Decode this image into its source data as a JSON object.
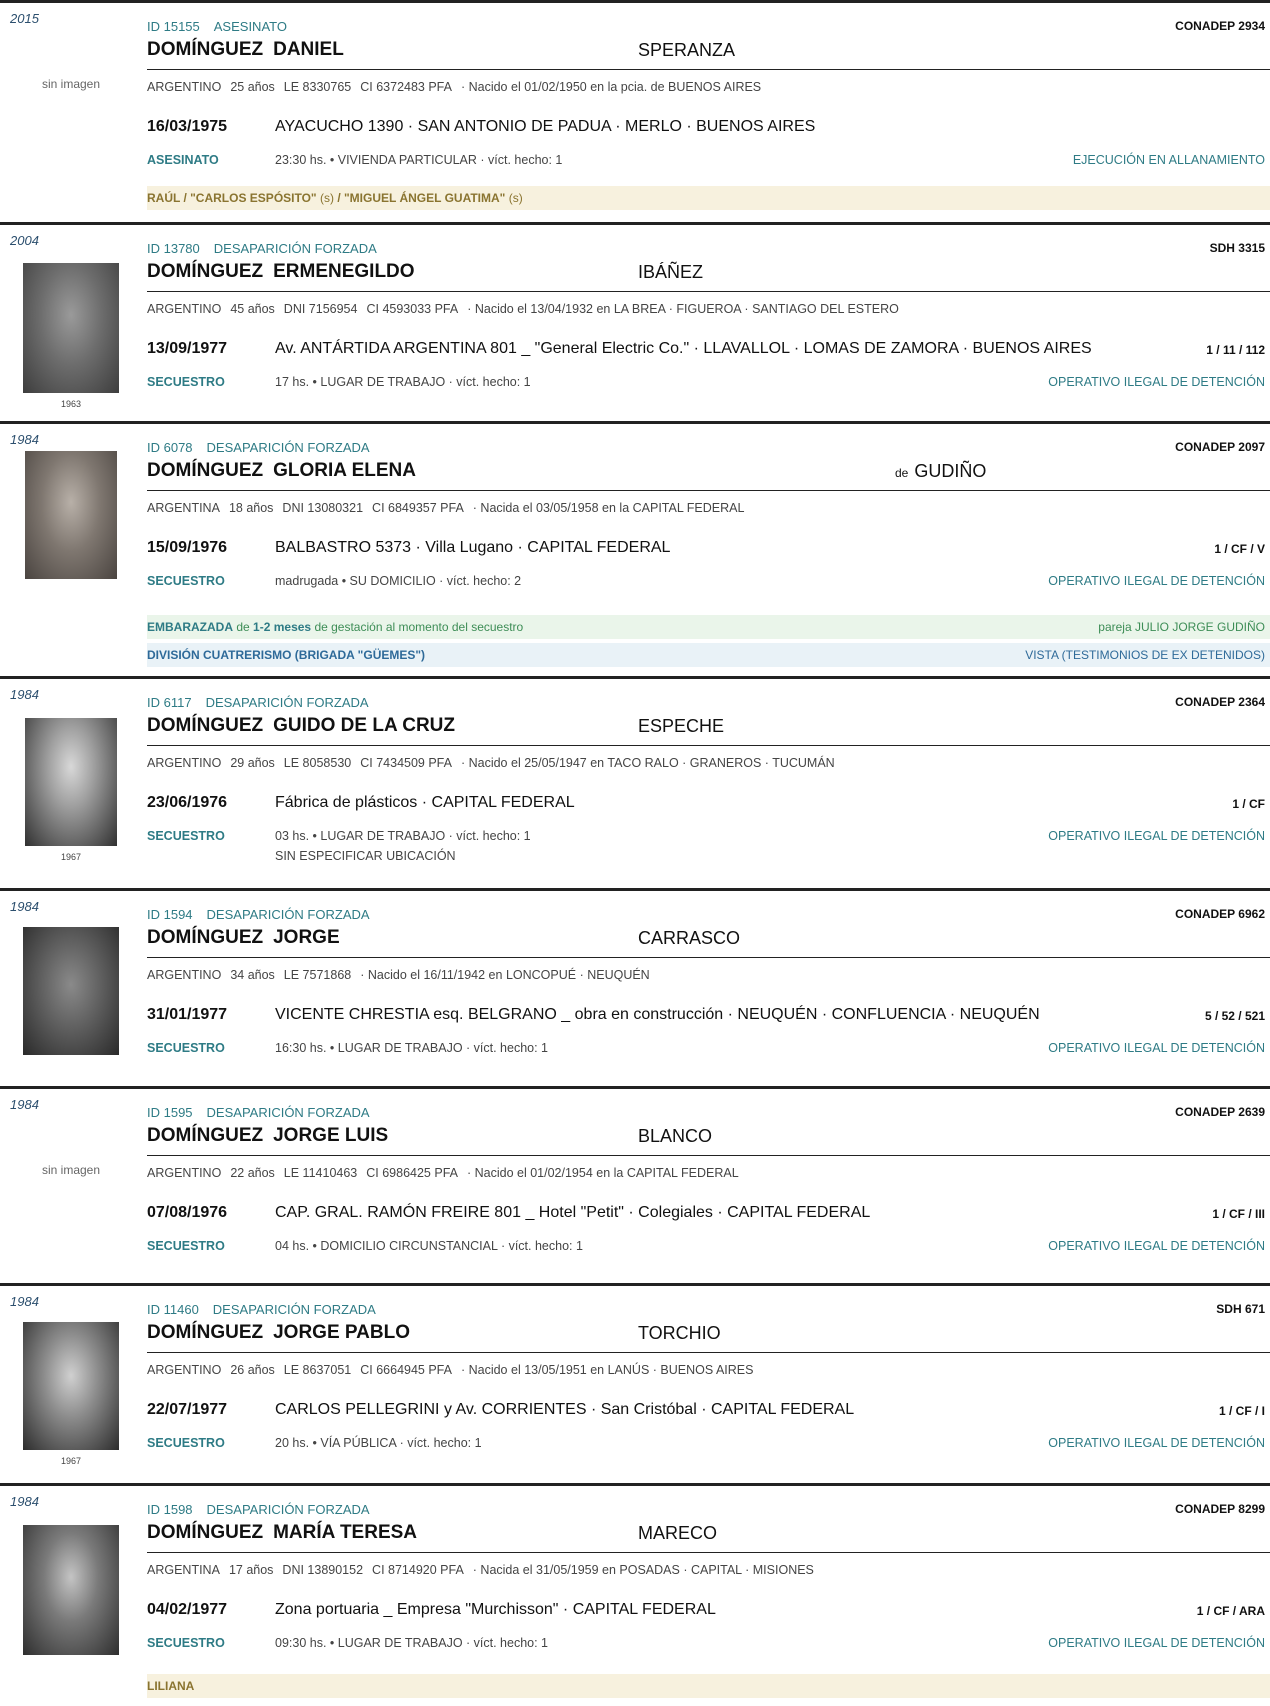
{
  "records": [
    {
      "year": "2015",
      "no_image": "sin imagen",
      "id": "ID 15155",
      "category": "ASESINATO",
      "source": "CONADEP  2934",
      "surname": "DOMÍNGUEZ",
      "firstname": "DANIEL",
      "maternal": "SPERANZA",
      "nationality": "ARGENTINO",
      "age": "25 años",
      "doc1": "LE 8330765",
      "doc2": "CI 6372483 PFA",
      "birth": "·  Nacido el 01/02/1950 en la pcia. de BUENOS AIRES",
      "event_date": "16/03/1975",
      "event_place": "AYACUCHO 1390   ·   SAN ANTONIO DE PADUA · MERLO · BUENOS AIRES",
      "type": "ASESINATO",
      "details": "23:30 hs.  •  VIVIENDA PARTICULAR  ·  víct. hecho: 1",
      "type_right": "EJECUCIÓN EN ALLANAMIENTO",
      "band_main": "RAÚL / \"CARLOS ESPÓSITO\"",
      "band_s1": "(s)",
      "band_mid": "/ \"MIGUEL ÁNGEL GUATIMA\"",
      "band_s2": "(s)"
    },
    {
      "year": "2004",
      "photo_year": "1963",
      "id": "ID 13780",
      "category": "DESAPARICIÓN FORZADA",
      "source": "SDH  3315",
      "surname": "DOMÍNGUEZ",
      "firstname": "ERMENEGILDO",
      "maternal": "IBÁÑEZ",
      "nationality": "ARGENTINO",
      "age": "45 años",
      "doc1": "DNI 7156954",
      "doc2": "CI 4593033 PFA",
      "birth": "·  Nacido el 13/04/1932 en LA BREA · FIGUEROA · SANTIAGO DEL ESTERO",
      "event_date": "13/09/1977",
      "event_place": "Av. ANTÁRTIDA ARGENTINA 801 _ \"General Electric Co.\"   ·   LLAVALLOL · LOMAS DE ZAMORA · BUENOS AIRES",
      "event_code": "1 / 11 / 112",
      "type": "SECUESTRO",
      "details": "17 hs.  •  LUGAR DE TRABAJO  ·  víct. hecho: 1",
      "type_right": "OPERATIVO ILEGAL DE DETENCIÓN"
    },
    {
      "year": "1984",
      "id": "ID 6078",
      "category": "DESAPARICIÓN FORZADA",
      "source": "CONADEP  2097",
      "surname": "DOMÍNGUEZ",
      "firstname": "GLORIA ELENA",
      "maternal_prefix": "de",
      "maternal": "GUDIÑO",
      "nationality": "ARGENTINA",
      "age": "18 años",
      "doc1": "DNI 13080321",
      "doc2": "CI 6849357 PFA",
      "birth": "·  Nacida el 03/05/1958 en la CAPITAL FEDERAL",
      "event_date": "15/09/1976",
      "event_place": "BALBASTRO 5373  ·  Villa Lugano  ·  CAPITAL FEDERAL",
      "event_code": "1 / CF / V",
      "type": "SECUESTRO",
      "details": "madrugada  •  SU DOMICILIO  ·  víct. hecho: 2",
      "type_right": "OPERATIVO ILEGAL DE DETENCIÓN",
      "preg_label": "EMBARAZADA",
      "preg_de": "de",
      "preg_months": "1-2 meses",
      "preg_rest": "de gestación al momento del secuestro",
      "preg_right": "pareja JULIO JORGE GUDIÑO",
      "unit": "DIVISIÓN CUATRERISMO (BRIGADA \"GÜEMES\")",
      "unit_right": "VISTA (TESTIMONIOS DE EX DETENIDOS)"
    },
    {
      "year": "1984",
      "photo_year": "1967",
      "id": "ID 6117",
      "category": "DESAPARICIÓN FORZADA",
      "source": "CONADEP  2364",
      "surname": "DOMÍNGUEZ",
      "firstname": "GUIDO DE LA CRUZ",
      "maternal": "ESPECHE",
      "nationality": "ARGENTINO",
      "age": "29 años",
      "doc1": "LE 8058530",
      "doc2": "CI 7434509 PFA",
      "birth": "·  Nacido el 25/05/1947 en TACO RALO · GRANEROS · TUCUMÁN",
      "event_date": "23/06/1976",
      "event_place": "Fábrica de plásticos   ·   CAPITAL FEDERAL",
      "event_code": "1 / CF",
      "type": "SECUESTRO",
      "details": "03 hs.  •  LUGAR DE TRABAJO  ·  víct. hecho: 1",
      "details2": "SIN ESPECIFICAR UBICACIÓN",
      "type_right": "OPERATIVO ILEGAL DE DETENCIÓN"
    },
    {
      "year": "1984",
      "id": "ID 1594",
      "category": "DESAPARICIÓN FORZADA",
      "source": "CONADEP  6962",
      "surname": "DOMÍNGUEZ",
      "firstname": "JORGE",
      "maternal": "CARRASCO",
      "nationality": "ARGENTINO",
      "age": "34 años",
      "doc1": "LE 7571868",
      "birth": "·  Nacido el 16/11/1942 en LONCOPUÉ · NEUQUÉN",
      "event_date": "31/01/1977",
      "event_place": "VICENTE CHRESTIA esq. BELGRANO _ obra en construcción   ·   NEUQUÉN · CONFLUENCIA · NEUQUÉN",
      "event_code": "5 / 52 / 521",
      "type": "SECUESTRO",
      "details": "16:30 hs.  •  LUGAR DE TRABAJO  ·  víct. hecho: 1",
      "type_right": "OPERATIVO ILEGAL DE DETENCIÓN"
    },
    {
      "year": "1984",
      "no_image": "sin imagen",
      "id": "ID 1595",
      "category": "DESAPARICIÓN FORZADA",
      "source": "CONADEP  2639",
      "surname": "DOMÍNGUEZ",
      "firstname": "JORGE LUIS",
      "maternal": "BLANCO",
      "nationality": "ARGENTINO",
      "age": "22 años",
      "doc1": "LE 11410463",
      "doc2": "CI 6986425 PFA",
      "birth": "·  Nacido el 01/02/1954 en la CAPITAL FEDERAL",
      "event_date": "07/08/1976",
      "event_place": "CAP. GRAL. RAMÓN FREIRE 801 _ Hotel \"Petit\"  ·  Colegiales   ·   CAPITAL FEDERAL",
      "event_code": "1 / CF / III",
      "type": "SECUESTRO",
      "details": "04 hs.  •  DOMICILIO CIRCUNSTANCIAL  ·  víct. hecho: 1",
      "type_right": "OPERATIVO ILEGAL DE DETENCIÓN"
    },
    {
      "year": "1984",
      "photo_year": "1967",
      "id": "ID 11460",
      "category": "DESAPARICIÓN FORZADA",
      "source": "SDH  671",
      "surname": "DOMÍNGUEZ",
      "firstname": "JORGE PABLO",
      "maternal": "TORCHIO",
      "nationality": "ARGENTINO",
      "age": "26 años",
      "doc1": "LE 8637051",
      "doc2": "CI 6664945 PFA",
      "birth": "·  Nacido el 13/05/1951 en LANÚS · BUENOS AIRES",
      "event_date": "22/07/1977",
      "event_place": "CARLOS PELLEGRINI y Av. CORRIENTES  ·  San Cristóbal  ·  CAPITAL FEDERAL",
      "event_code": "1 / CF / I",
      "type": "SECUESTRO",
      "details": "20 hs.  •  VÍA PÚBLICA  ·  víct. hecho: 1",
      "type_right": "OPERATIVO ILEGAL DE DETENCIÓN"
    },
    {
      "year": "1984",
      "id": "ID 1598",
      "category": "DESAPARICIÓN FORZADA",
      "source": "CONADEP  8299",
      "surname": "DOMÍNGUEZ",
      "firstname": "MARÍA TERESA",
      "maternal": "MARECO",
      "nationality": "ARGENTINA",
      "age": "17 años",
      "doc1": "DNI 13890152",
      "doc2": "CI 8714920 PFA",
      "birth": "·  Nacida el 31/05/1959 en POSADAS · CAPITAL · MISIONES",
      "event_date": "04/02/1977",
      "event_place": "Zona portuaria _ Empresa \"Murchisson\"   ·   CAPITAL FEDERAL",
      "event_code": "1 / CF / ARA",
      "type": "SECUESTRO",
      "details": "09:30 hs.  •  LUGAR DE TRABAJO  ·  víct. hecho: 1",
      "type_right": "OPERATIVO ILEGAL DE DETENCIÓN",
      "band_main": "LILIANA"
    }
  ]
}
